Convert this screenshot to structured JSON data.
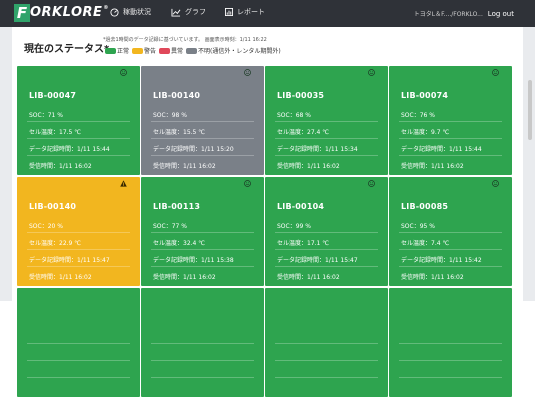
{
  "nav": {
    "brand_initial": "F",
    "brand_rest": "ORKLORE",
    "brand_reg": "®",
    "links": [
      {
        "label": "稼動状況",
        "icon": "gauge-icon"
      },
      {
        "label": "グラフ",
        "icon": "line-chart-icon"
      },
      {
        "label": "レポート",
        "icon": "report-icon"
      }
    ],
    "user": "トヨタL＆F..../FORKLO...",
    "logout": "Log out"
  },
  "page": {
    "title": "現在のステータス*",
    "note": "*過去1時間のデータ記録に基づいています。 画面表示時刻：1/11 16:22",
    "legend": [
      {
        "label": "正常",
        "color": "#2ea44f"
      },
      {
        "label": "警告",
        "color": "#f2b61f"
      },
      {
        "label": "異常",
        "color": "#e0485a"
      },
      {
        "label": "不明(通信外・レンタル期間外)",
        "color": "#7a8088"
      }
    ]
  },
  "labels": {
    "soc": "SOC：",
    "temp": "セル温度：",
    "recorded": "データ記録時間：",
    "received": "受信時間："
  },
  "cards": [
    {
      "id": "LIB-00047",
      "status": "green",
      "icon": "smiley-icon",
      "soc": "71 %",
      "temp": "17.5 ℃",
      "recorded": "1/11 15:44",
      "received": "1/11 16:02"
    },
    {
      "id": "LIB-00140",
      "status": "gray",
      "icon": "smiley-icon",
      "soc": "98 %",
      "temp": "15.5 ℃",
      "recorded": "1/11 15:20",
      "received": "1/11 16:02"
    },
    {
      "id": "LIB-00035",
      "status": "green",
      "icon": "smiley-icon",
      "soc": "68 %",
      "temp": "27.4 ℃",
      "recorded": "1/11 15:34",
      "received": "1/11 16:02"
    },
    {
      "id": "LIB-00074",
      "status": "green",
      "icon": "smiley-icon",
      "soc": "76 %",
      "temp": "9.7 ℃",
      "recorded": "1/11 15:44",
      "received": "1/11 16:02"
    },
    {
      "id": "LIB-00140",
      "status": "yellow",
      "icon": "warning-icon",
      "soc": "20 %",
      "temp": "22.9 ℃",
      "recorded": "1/11 15:47",
      "received": "1/11 16:02"
    },
    {
      "id": "LIB-00113",
      "status": "green",
      "icon": "smiley-icon",
      "soc": "77 %",
      "temp": "32.4 ℃",
      "recorded": "1/11 15:38",
      "received": "1/11 16:02"
    },
    {
      "id": "LIB-00104",
      "status": "green",
      "icon": "smiley-icon",
      "soc": "99 %",
      "temp": "17.1 ℃",
      "recorded": "1/11 15:47",
      "received": "1/11 16:02"
    },
    {
      "id": "LIB-00085",
      "status": "green",
      "icon": "smiley-icon",
      "soc": "95 %",
      "temp": "7.4 ℃",
      "recorded": "1/11 15:42",
      "received": "1/11 16:02"
    },
    {
      "id": "",
      "status": "green",
      "icon": "",
      "soc": "",
      "temp": "",
      "recorded": "",
      "received": ""
    },
    {
      "id": "",
      "status": "green",
      "icon": "",
      "soc": "",
      "temp": "",
      "recorded": "",
      "received": ""
    },
    {
      "id": "",
      "status": "green",
      "icon": "",
      "soc": "",
      "temp": "",
      "recorded": "",
      "received": ""
    },
    {
      "id": "",
      "status": "green",
      "icon": "",
      "soc": "",
      "temp": "",
      "recorded": "",
      "received": ""
    }
  ]
}
